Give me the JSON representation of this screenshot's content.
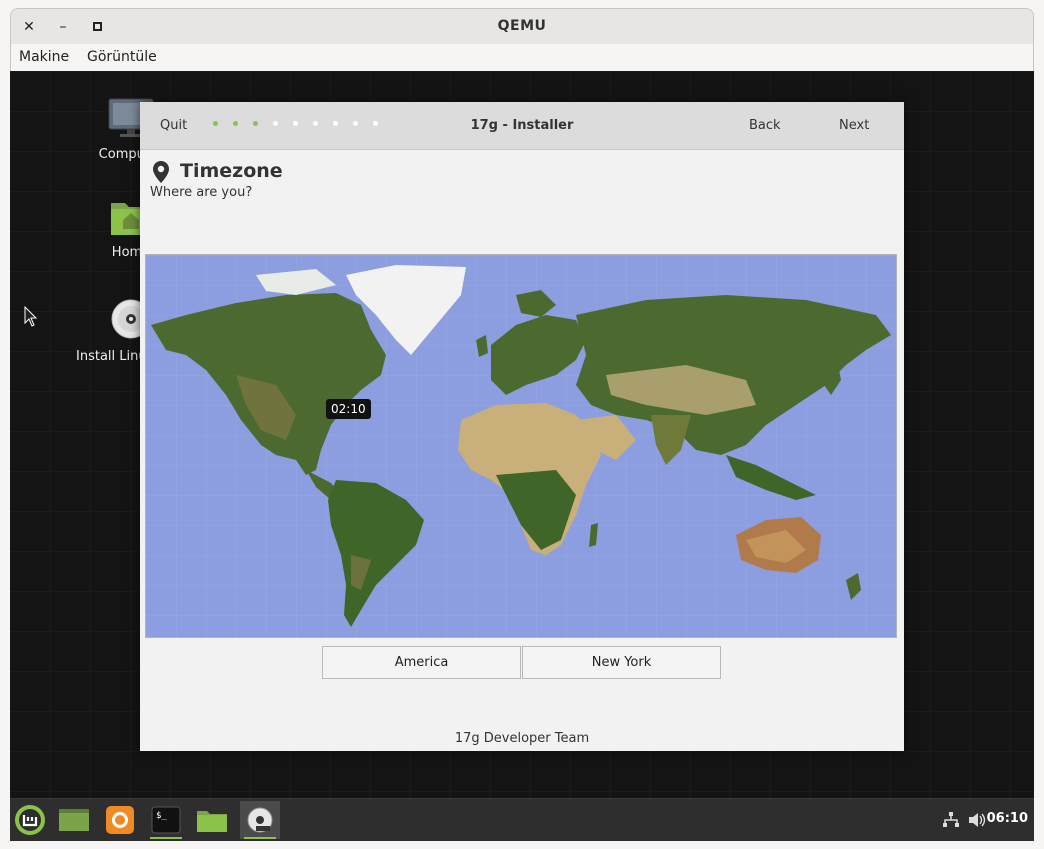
{
  "qemu": {
    "title": "QEMU",
    "menu": [
      "Makine",
      "Görüntüle"
    ]
  },
  "desktop": {
    "icons": [
      {
        "label": "Computer",
        "icon": "computer-icon"
      },
      {
        "label": "Home",
        "icon": "home-folder-icon"
      },
      {
        "label": "Install Linux Mint",
        "icon": "install-disc-icon"
      }
    ]
  },
  "installer": {
    "quit": "Quit",
    "title": "17g - Installer",
    "back": "Back",
    "next": "Next",
    "steps_total": 9,
    "steps_done": 3,
    "page_icon": "location-pin-icon",
    "page_title": "Timezone",
    "page_subtitle": "Where are you?",
    "map_time": "02:10",
    "region": "America",
    "city": "New York",
    "footer": "17g Developer Team"
  },
  "taskbar": {
    "apps": [
      "mint-menu-icon",
      "show-desktop-icon",
      "firefox-icon",
      "terminal-icon",
      "files-icon",
      "installer-disc-icon"
    ],
    "active_app": "installer-disc-icon",
    "tray_icons": [
      "network-icon",
      "volume-icon"
    ],
    "clock": "06:10"
  },
  "colors": {
    "accent": "#8bc34a",
    "ocean": "#8c9ee0",
    "land": "#4c6a30",
    "desert": "#c9b07a",
    "ice": "#f2f2f2"
  }
}
